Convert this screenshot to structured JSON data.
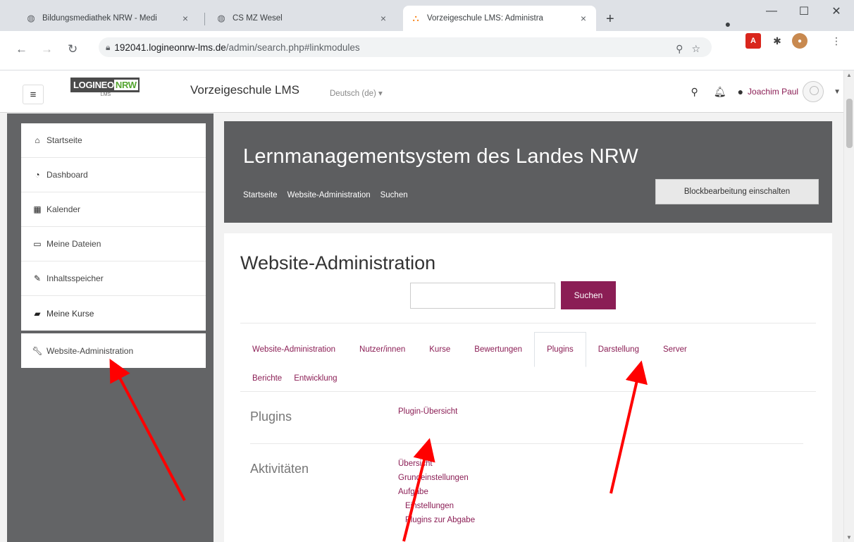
{
  "browser": {
    "tabs": [
      {
        "title": "Bildungsmediathek NRW - Medi",
        "icon": "globe-icon"
      },
      {
        "title": "CS MZ Wesel",
        "icon": "globe-icon"
      },
      {
        "title": "Vorzeigeschule LMS: Administra",
        "icon": "moodle-icon"
      }
    ],
    "url_host": "192041.logineonrw-lms.de",
    "url_path": "/admin/search.php#linkmodules"
  },
  "navbar": {
    "logo_text_a": "LOGINEO",
    "logo_text_b": "NRW",
    "logo_sub": "LMS",
    "site_name": "Vorzeigeschule LMS",
    "language": "Deutsch (de) ▾",
    "user_name": "Joachim Paul"
  },
  "sidebar": {
    "items": [
      {
        "label": "Startseite",
        "icon": "home-icon"
      },
      {
        "label": "Dashboard",
        "icon": "dashboard-icon"
      },
      {
        "label": "Kalender",
        "icon": "calendar-icon"
      },
      {
        "label": "Meine Dateien",
        "icon": "file-icon"
      },
      {
        "label": "Inhaltsspeicher",
        "icon": "pencil-icon"
      },
      {
        "label": "Meine Kurse",
        "icon": "graduation-cap-icon"
      }
    ],
    "admin_item": {
      "label": "Website-Administration",
      "icon": "wrench-icon"
    }
  },
  "header": {
    "title": "Lernmanagementsystem des Landes NRW",
    "breadcrumbs": [
      "Startseite",
      "Website-Administration",
      "Suchen"
    ],
    "block_button": "Blockbearbeitung einschalten"
  },
  "content": {
    "title": "Website-Administration",
    "search_button": "Suchen",
    "tabs_row1": [
      "Website-Administration",
      "Nutzer/innen",
      "Kurse",
      "Bewertungen",
      "Plugins",
      "Darstellung",
      "Server"
    ],
    "tabs_row2": [
      "Berichte",
      "Entwicklung"
    ],
    "active_tab": "Plugins",
    "sections": [
      {
        "label": "Plugins",
        "links": [
          "Plugin-Übersicht"
        ]
      },
      {
        "label": "Aktivitäten",
        "links": [
          "Übersicht",
          "Grundeinstellungen",
          "Aufgabe",
          "Einstellungen",
          "Plugins zur Abgabe"
        ]
      }
    ]
  },
  "colors": {
    "accent": "#8b1e55",
    "drawer": "#636466",
    "header_card": "#5d5e60",
    "annotation": "#ff0000"
  }
}
